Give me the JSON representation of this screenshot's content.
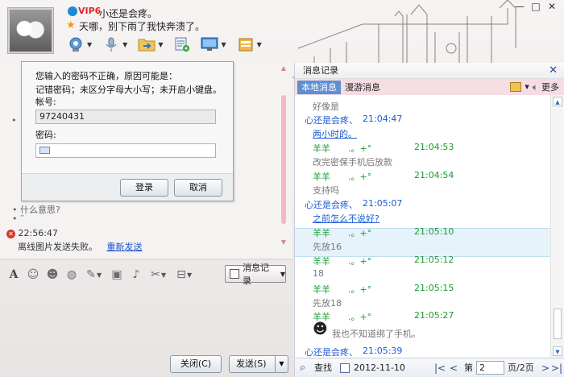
{
  "window": {
    "nickname": "小还是会疼。",
    "vip_badge": "VIP6",
    "signature": "天哪，别下雨了我快奔溃了。",
    "controls": [
      "—",
      "□",
      "✕"
    ]
  },
  "toolbar_top": {
    "items": [
      "video-camera",
      "microphone",
      "transfer-file",
      "remote-assist",
      "screen-share",
      "app-box"
    ]
  },
  "login_popup": {
    "line1": "您输入的密码不正确，原因可能是：",
    "line2": "记错密码；未区分字母大小写；未开启小键盘。",
    "account_label": "帐号:",
    "account_value": "97240431",
    "password_label": "密码:",
    "login_button": "登录",
    "cancel_button": "取消"
  },
  "chat": {
    "line_question": "• 什么意思?",
    "line_dots": "• ′′",
    "error_time": "22:56:47",
    "error_text": "离线图片发送失败。",
    "resend_link": "重新发送"
  },
  "input_toolbar": {
    "message_record_button": "消息记录"
  },
  "bottom_buttons": {
    "close": "关闭(C)",
    "send": "发送(S)"
  },
  "history": {
    "title": "消息记录",
    "tab_local": "本地消息",
    "tab_roaming": "漫游消息",
    "more": "更多",
    "messages": [
      {
        "sender": "",
        "time": "",
        "text": "好像是",
        "type": "text"
      },
      {
        "sender": "心还是会疼、",
        "time": "21:04:47",
        "text": "",
        "type": "other"
      },
      {
        "sender": "",
        "time": "",
        "text": "两小时的。",
        "type": "blue"
      },
      {
        "sender": "羊羊　　.。+°",
        "time": "21:04:53",
        "text": "",
        "type": "me"
      },
      {
        "sender": "",
        "time": "",
        "text": "改完密保手机后放款",
        "type": "text"
      },
      {
        "sender": "羊羊　　.。+°",
        "time": "21:04:54",
        "text": "",
        "type": "me"
      },
      {
        "sender": "",
        "time": "",
        "text": "支持吗",
        "type": "text"
      },
      {
        "sender": "心还是会疼、",
        "time": "21:05:07",
        "text": "",
        "type": "other"
      },
      {
        "sender": "",
        "time": "",
        "text": "之前怎么不说好?",
        "type": "blue"
      },
      {
        "sender": "羊羊　　.。+°",
        "time": "21:05:10",
        "text": "",
        "type": "me"
      },
      {
        "sender": "",
        "time": "",
        "text": "先放16",
        "type": "text"
      },
      {
        "sender": "羊羊　　.。+°",
        "time": "21:05:12",
        "text": "",
        "type": "me"
      },
      {
        "sender": "",
        "time": "",
        "text": "18",
        "type": "text"
      },
      {
        "sender": "羊羊　　.。+°",
        "time": "21:05:15",
        "text": "",
        "type": "me"
      },
      {
        "sender": "",
        "time": "",
        "text": "先放18",
        "type": "text"
      },
      {
        "sender": "羊羊　　.。+°",
        "time": "21:05:27",
        "text": "",
        "type": "me"
      },
      {
        "sender": "",
        "time": "",
        "text": "我也不知道绑了手机。",
        "type": "emoji"
      },
      {
        "sender": "心还是会疼、",
        "time": "21:05:39",
        "text": "",
        "type": "other"
      }
    ],
    "search": "查找",
    "date": "2012-11-10",
    "page_prefix": "第",
    "page_value": "2",
    "page_suffix": "页/2页"
  }
}
